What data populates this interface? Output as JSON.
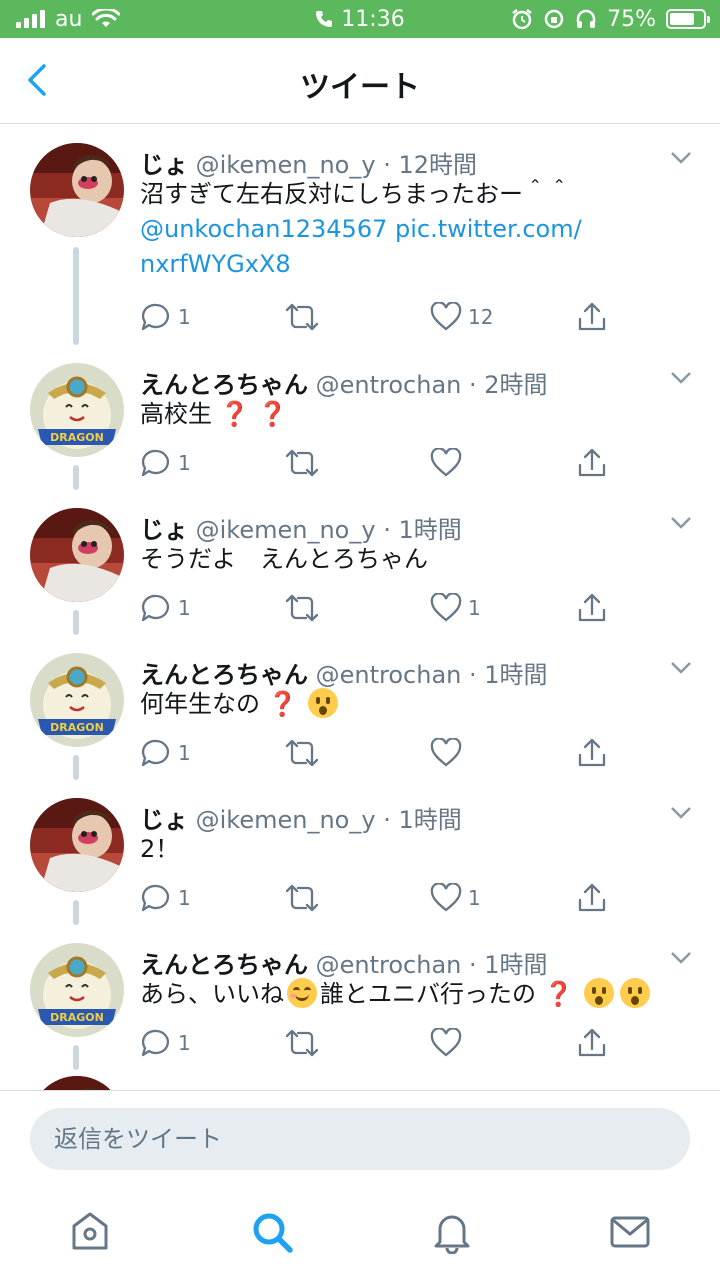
{
  "status_bar": {
    "carrier": "au",
    "time": "11:36",
    "battery": "75%",
    "battery_level": 0.75,
    "accent_color": "#5cb85c"
  },
  "header": {
    "title": "ツイート",
    "back_icon": "chevron-left-icon"
  },
  "tweets": [
    {
      "name": "じょ",
      "handle": "@ikemen_no_y",
      "time": "· 12時間",
      "text": "沼すぎて左右反対にしちまったおー＾＾",
      "mention": "@unkochan1234567",
      "link1": "pic.twitter.com/",
      "link2": "nxrfWYGxX8",
      "replies": "1",
      "retweets": "",
      "likes": "12"
    },
    {
      "name": "えんとろちゃん",
      "handle": "@entrochan",
      "time": "· 2時間",
      "text": "高校生",
      "emoji": "❓ ❓",
      "replies": "1",
      "retweets": "",
      "likes": ""
    },
    {
      "name": "じょ",
      "handle": "@ikemen_no_y",
      "time": "· 1時間",
      "text": "そうだよ　えんとろちゃん",
      "replies": "1",
      "retweets": "",
      "likes": "1"
    },
    {
      "name": "えんとろちゃん",
      "handle": "@entrochan",
      "time": "· 1時間",
      "text": "何年生なの",
      "emoji": "❓",
      "replies": "1",
      "retweets": "",
      "likes": ""
    },
    {
      "name": "じょ",
      "handle": "@ikemen_no_y",
      "time": "· 1時間",
      "text": "2！",
      "replies": "1",
      "retweets": "",
      "likes": "1"
    },
    {
      "name": "えんとろちゃん",
      "handle": "@entrochan",
      "time": "· 1時間",
      "text_a": "あら、いいね",
      "text_b": "誰とユニバ行ったの",
      "emoji": "❓",
      "replies": "1",
      "retweets": "",
      "likes": ""
    }
  ],
  "reply_bar": {
    "placeholder": "返信をツイート"
  },
  "tab_bar": {
    "tabs": [
      "home-icon",
      "search-icon",
      "notifications-icon",
      "messages-icon"
    ],
    "active": "search-icon",
    "active_color": "#1da1f2"
  },
  "colors": {
    "link": "#1b95e0",
    "secondary": "#657786",
    "thread_line": "#ccd6dd"
  }
}
